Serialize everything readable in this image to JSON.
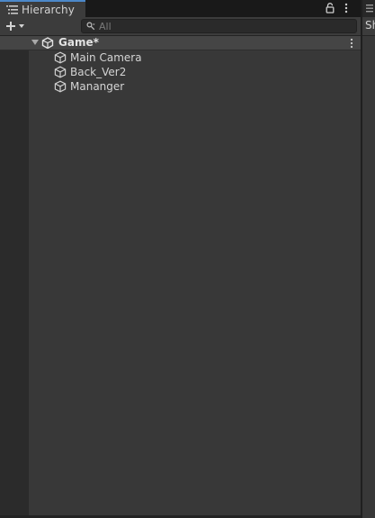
{
  "hierarchy": {
    "tab_title": "Hierarchy",
    "tab_icon": "list-icon",
    "lock_icon": "lock-icon",
    "more_icon": "kebab-menu-icon",
    "add_icon": "plus-icon",
    "search": {
      "placeholder": "All",
      "value": ""
    },
    "scene": {
      "name": "Game*",
      "expanded": true,
      "icon": "unity-scene-icon",
      "menu_icon": "kebab-menu-icon"
    },
    "objects": [
      {
        "label": "Main Camera",
        "icon": "gameobject-cube-icon"
      },
      {
        "label": "Back_Ver2",
        "icon": "gameobject-cube-icon"
      },
      {
        "label": "Mananger",
        "icon": "gameobject-cube-icon"
      }
    ]
  },
  "right_panel": {
    "toolbar_text": "Sh"
  },
  "colors": {
    "tab_accent": "#4c88c9",
    "panel_bg": "#383838",
    "scene_row_bg": "#454545",
    "gutter_bg": "#2b2b2b",
    "text": "#d4d4d4"
  }
}
